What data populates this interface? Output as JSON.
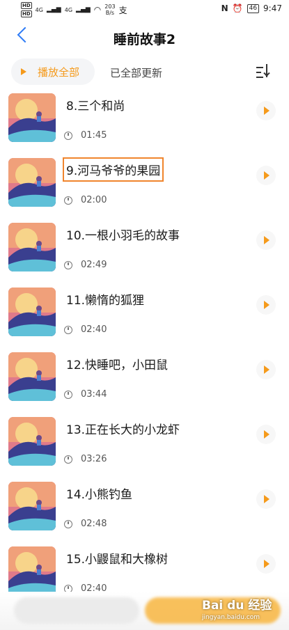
{
  "status_bar": {
    "sim1": "HD",
    "sim2": "HD",
    "signal1": "4G",
    "signal2": "4G",
    "net_speed": "203",
    "net_unit": "B/s",
    "app_icon": "alipay-icon",
    "nfc": "N",
    "battery": "46",
    "time": "9:47"
  },
  "header": {
    "title": "睡前故事2"
  },
  "toolbar": {
    "play_all_label": "播放全部",
    "updated_label": "已全部更新"
  },
  "stories": [
    {
      "name": "8.三个和尚",
      "duration": "01:45"
    },
    {
      "name": "9.河马爷爷的果园",
      "duration": "02:00"
    },
    {
      "name": "10.一根小羽毛的故事",
      "duration": "02:49"
    },
    {
      "name": "11.懒惰的狐狸",
      "duration": "02:40"
    },
    {
      "name": "12.快睡吧，小田鼠",
      "duration": "03:44"
    },
    {
      "name": "13.正在长大的小龙虾",
      "duration": "03:26"
    },
    {
      "name": "14.小熊钓鱼",
      "duration": "02:48"
    },
    {
      "name": "15.小鼹鼠和大橡树",
      "duration": "02:40"
    }
  ],
  "watermark": {
    "brand": "Bai du 经验",
    "url": "jingyan.baidu.com"
  }
}
